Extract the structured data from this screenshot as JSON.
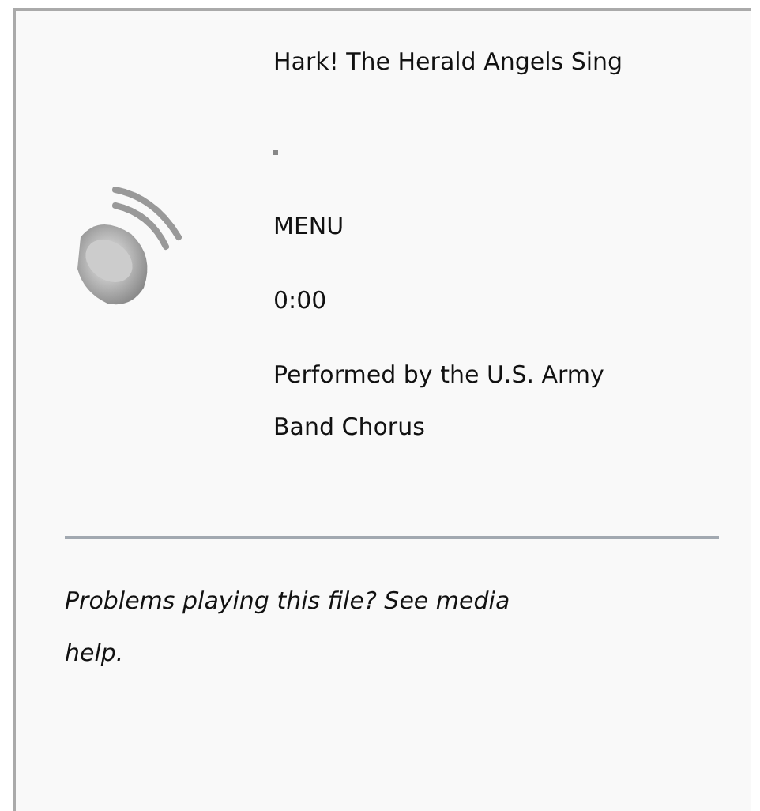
{
  "title": "Hark! The Herald Angels Sing",
  "menu": "MENU",
  "time": "0:00",
  "credit": "Performed by the U.S. Army Band Chorus",
  "help": "Problems playing this file? See media help."
}
